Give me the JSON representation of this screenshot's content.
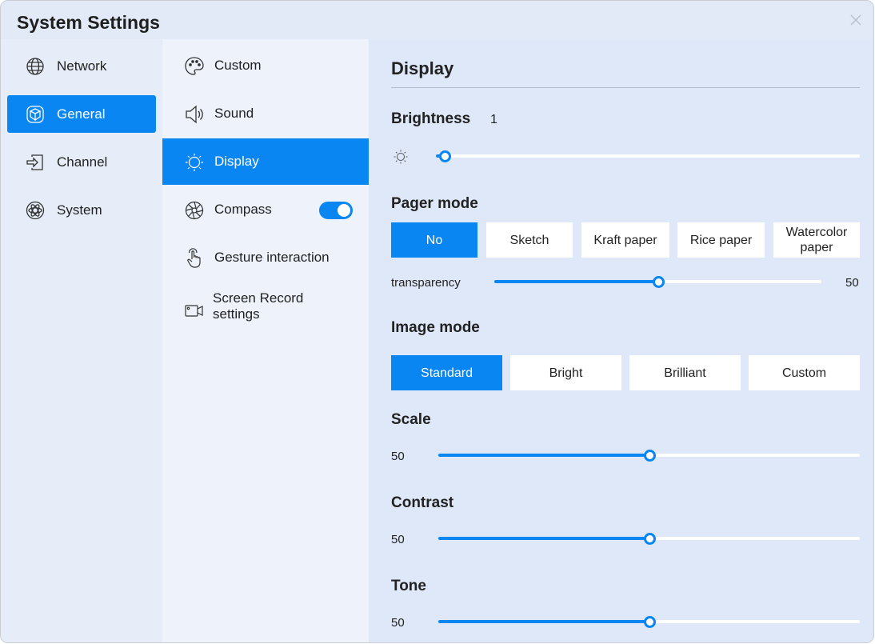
{
  "window": {
    "title": "System Settings"
  },
  "nav": [
    {
      "label": "Network",
      "icon": "globe-icon"
    },
    {
      "label": "General",
      "icon": "cube-icon",
      "active": true
    },
    {
      "label": "Channel",
      "icon": "input-icon"
    },
    {
      "label": "System",
      "icon": "atom-icon"
    }
  ],
  "subnav": [
    {
      "label": "Custom",
      "icon": "palette-icon"
    },
    {
      "label": "Sound",
      "icon": "speaker-icon"
    },
    {
      "label": "Display",
      "icon": "sun-icon",
      "active": true
    },
    {
      "label": "Compass",
      "icon": "compass-icon",
      "toggle": true
    },
    {
      "label": "Gesture interaction",
      "icon": "hand-pointer-icon"
    },
    {
      "label": "Screen Record settings",
      "icon": "camera-icon"
    }
  ],
  "display": {
    "heading": "Display",
    "brightness": {
      "label": "Brightness",
      "value": "1",
      "level": 0.02
    },
    "pager": {
      "label": "Pager mode",
      "options": [
        "No",
        "Sketch",
        "Kraft paper",
        "Rice paper",
        "Watercolor paper"
      ],
      "selected": "No",
      "transparency_label": "transparency",
      "transparency_value": "50",
      "transparency_level": 0.5
    },
    "image_mode": {
      "label": "Image mode",
      "options": [
        "Standard",
        "Bright",
        "Brilliant",
        "Custom"
      ],
      "selected": "Standard"
    },
    "scale": {
      "label": "Scale",
      "value": "50",
      "level": 0.5
    },
    "contrast": {
      "label": "Contrast",
      "value": "50",
      "level": 0.5
    },
    "tone": {
      "label": "Tone",
      "value": "50",
      "level": 0.5
    }
  },
  "colors": {
    "accent": "#0a86f3",
    "panel": "#dee8f8"
  }
}
